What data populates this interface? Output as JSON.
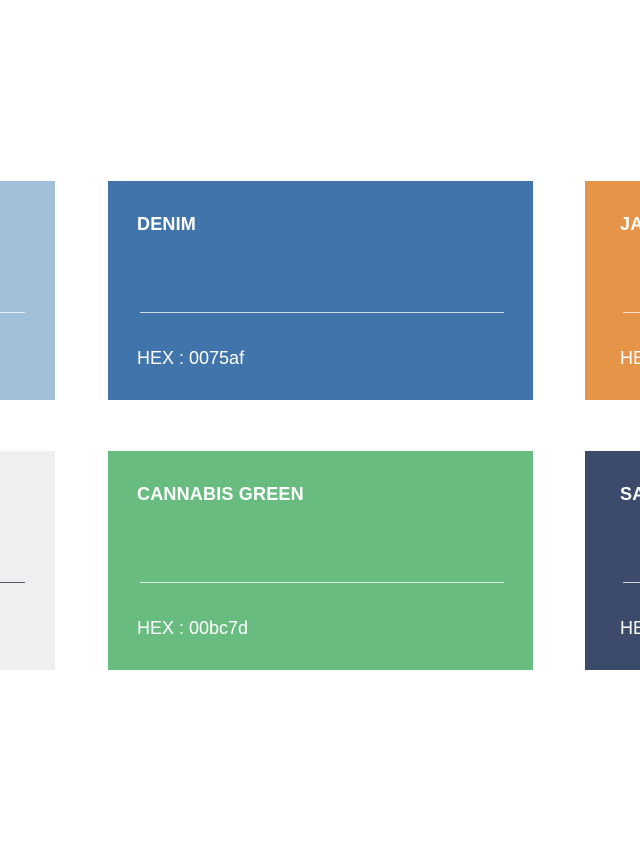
{
  "swatches": [
    {
      "id": "light-blue",
      "name": "",
      "hex_text": "",
      "color": "#a0c0da"
    },
    {
      "id": "denim",
      "name": "DENIM",
      "hex_text": "HEX : 0075af",
      "color": "#4074aa"
    },
    {
      "id": "ja",
      "name": "JA",
      "hex_text": "HE",
      "color": "#e69447"
    },
    {
      "id": "light-grey",
      "name": "",
      "hex_text": "",
      "color": "#efeef0"
    },
    {
      "id": "cannabis-green",
      "name": "CANNABIS GREEN",
      "hex_text": "HEX : 00bc7d",
      "color": "#68bc7f"
    },
    {
      "id": "sa",
      "name": "SA",
      "hex_text": "HE",
      "color": "#3c4b6b"
    }
  ]
}
